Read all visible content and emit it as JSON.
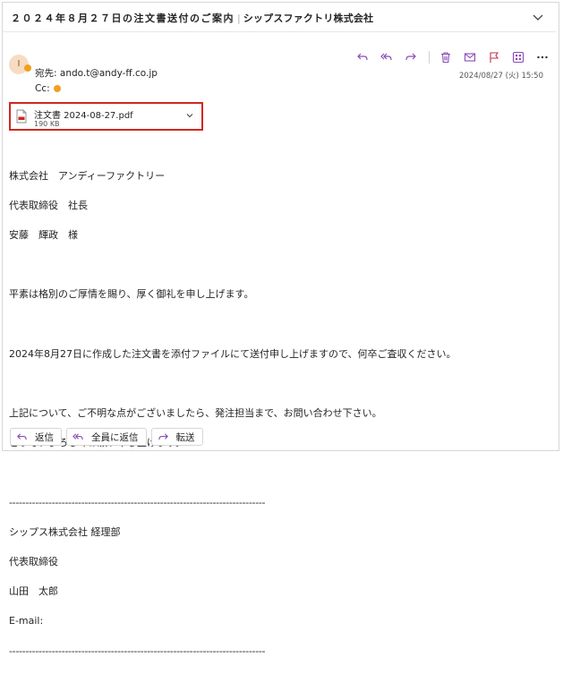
{
  "message": {
    "subject": "２０２４年８月２７日の注文書送付のご案内",
    "subject_sender": "シップスファクトリ株式会社",
    "avatar_initial": "I",
    "to_label": "宛先:",
    "to_address": "ando.t@andy-ff.co.jp",
    "cc_label": "Cc:",
    "date": "2024/08/27 (火) 15:50"
  },
  "attachment": {
    "filename": "注文書 2024-08-27.pdf",
    "size": "190 KB"
  },
  "body": {
    "lines_1": [
      "株式会社　アンディーファクトリー",
      "代表取締役　社長",
      "安藤　輝政　様"
    ],
    "line_2": "平素は格別のご厚情を賜り、厚く御礼を申し上げます。",
    "line_3": "2024年8月27日に作成した注文書を添付ファイルにて送付申し上げますので、何卒ご査収ください。",
    "lines_4": [
      "上記について、ご不明な点がございましたら、発注担当まで、お問い合わせ下さい。",
      "どうぞ、よろしくお願い申し上げます。"
    ],
    "divider": "------------------------------------------------------------------------------",
    "signature": [
      "シップス株式会社 経理部",
      "代表取締役",
      "山田　太郎",
      "E-mail:"
    ]
  },
  "reply_bar": {
    "reply": "返信",
    "reply_all": "全員に返信",
    "forward": "転送"
  },
  "colors": {
    "accent": "#8a4bb5",
    "attachment_border": "#d1281f",
    "presence": "#f0a020"
  }
}
